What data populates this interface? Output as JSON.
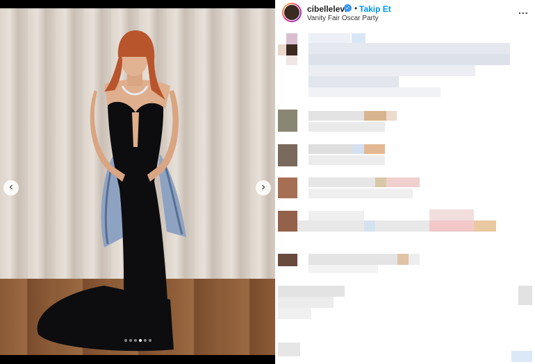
{
  "post": {
    "username": "cibellelevi",
    "verified_icon": "verified-badge-icon",
    "separator": "•",
    "follow_label": "Takip Et",
    "location": "Vanity Fair Oscar Party",
    "more_label": "..."
  },
  "carousel": {
    "prev_label": "‹",
    "next_label": "›",
    "slide_count": 6,
    "active_slide": 4
  },
  "colors": {
    "follow": "#0095f6",
    "verified": "#3897f0",
    "dress": "#0d0d0f"
  }
}
